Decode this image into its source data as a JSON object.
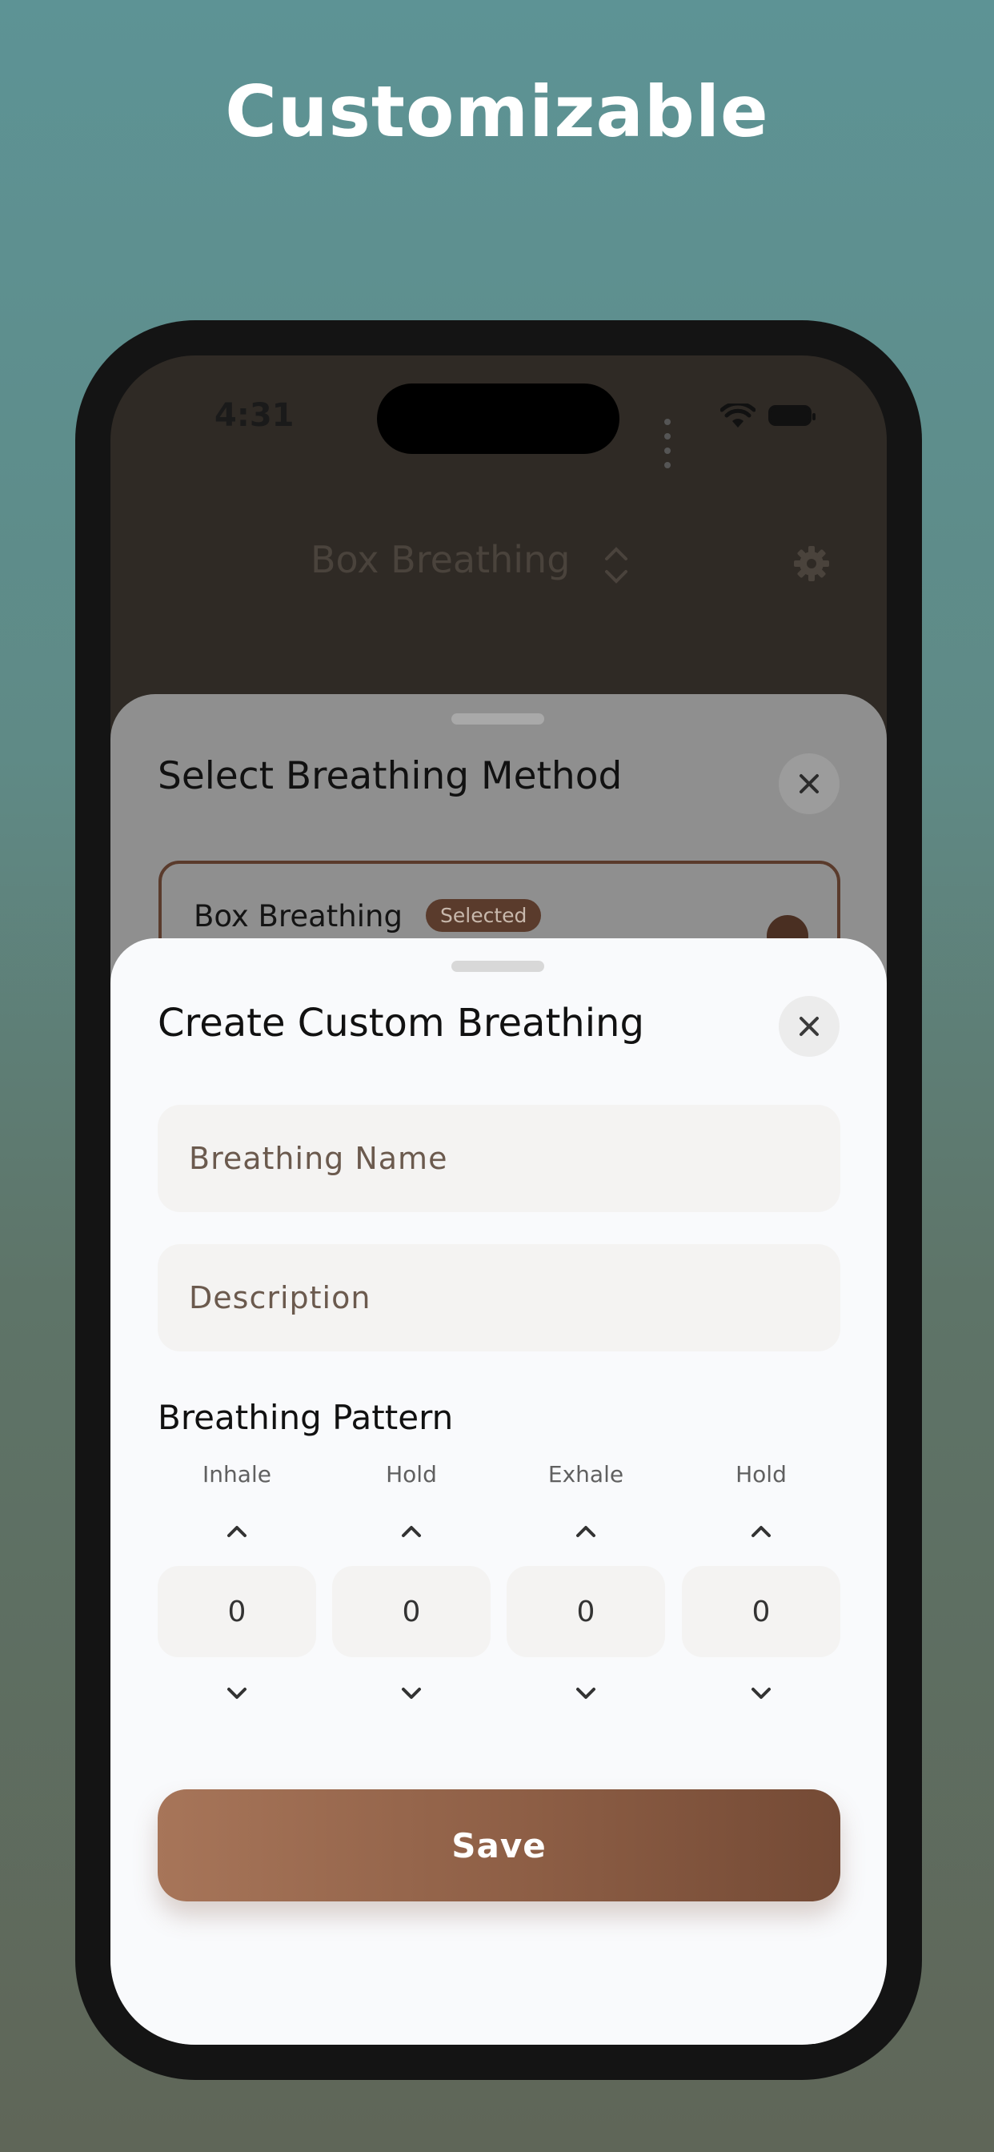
{
  "headline": "Customizable",
  "status_bar": {
    "time": "4:31"
  },
  "nav": {
    "title": "Box Breathing"
  },
  "method_sheet": {
    "title": "Select Breathing Method",
    "items": [
      {
        "name": "Box Breathing",
        "badge": "Selected",
        "selected": true
      }
    ]
  },
  "custom_sheet": {
    "title": "Create Custom Breathing",
    "name_placeholder": "Breathing Name",
    "description_placeholder": "Description",
    "pattern_label": "Breathing Pattern",
    "pattern": [
      {
        "label": "Inhale",
        "value": "0"
      },
      {
        "label": "Hold",
        "value": "0"
      },
      {
        "label": "Exhale",
        "value": "0"
      },
      {
        "label": "Hold",
        "value": "0"
      }
    ],
    "save_label": "Save"
  },
  "colors": {
    "accent": "#8d5e45",
    "accent_dark": "#5a3b2c",
    "background_top": "#5d9395",
    "background_bottom": "#5f6658"
  },
  "icons": {
    "close": "close-icon",
    "settings": "gear-icon",
    "increment": "chevron-up-icon",
    "decrement": "chevron-down-icon",
    "sort": "chevron-up-down-icon"
  }
}
